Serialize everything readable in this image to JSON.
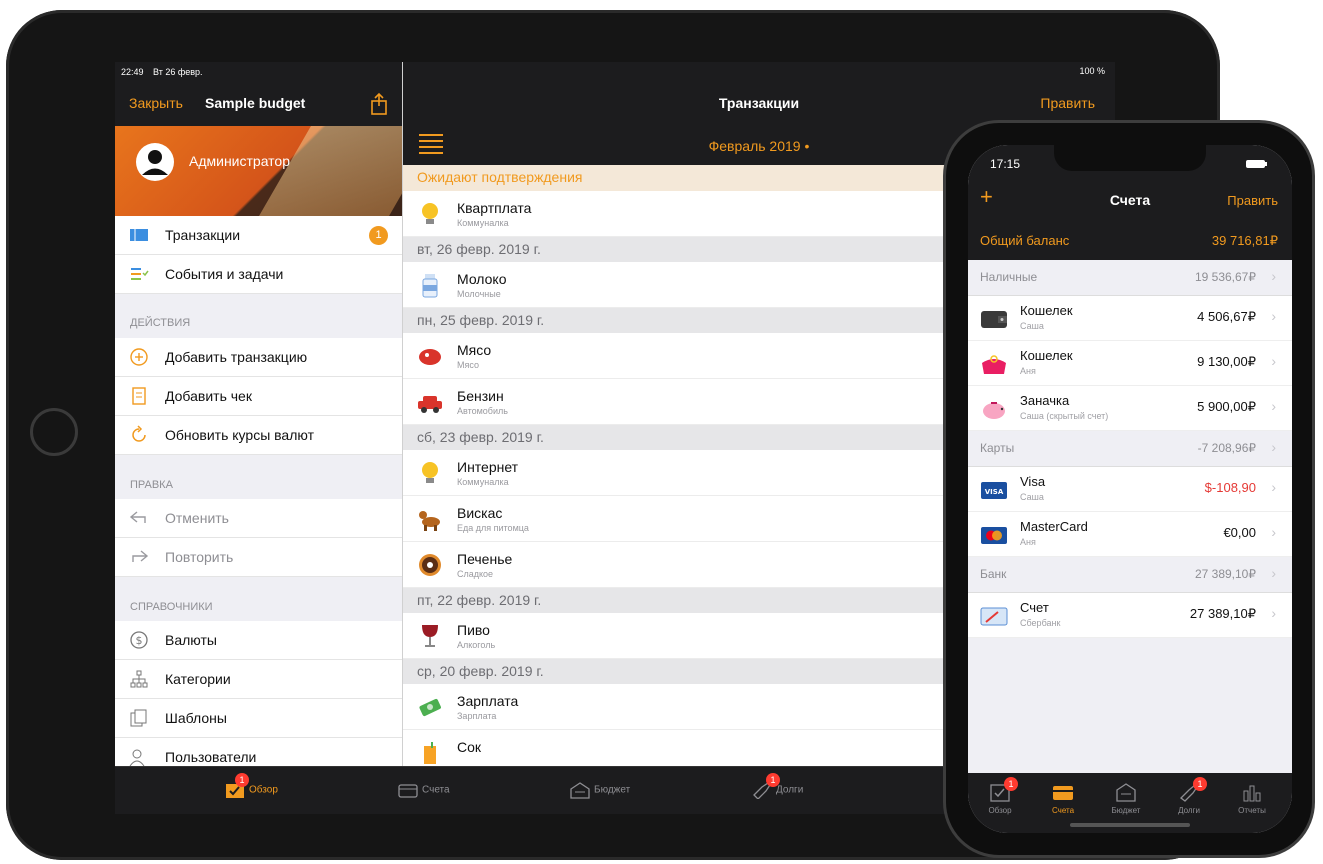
{
  "ipad": {
    "status": {
      "time": "22:49",
      "date": "Вт 26 февр.",
      "battery": "100 %"
    },
    "sidebar": {
      "close_label": "Закрыть",
      "title": "Sample budget",
      "user": "Администратор",
      "top_items": [
        {
          "label": "Транзакции",
          "badge": "1"
        },
        {
          "label": "События и задачи"
        }
      ],
      "actions_header": "ДЕЙСТВИЯ",
      "actions": [
        {
          "label": "Добавить транзакцию"
        },
        {
          "label": "Добавить чек"
        },
        {
          "label": "Обновить курсы валют"
        }
      ],
      "edit_header": "ПРАВКА",
      "edit_items": [
        {
          "label": "Отменить"
        },
        {
          "label": "Повторить"
        }
      ],
      "refs_header": "СПРАВОЧНИКИ",
      "refs": [
        {
          "label": "Валюты"
        },
        {
          "label": "Категории"
        },
        {
          "label": "Шаблоны"
        },
        {
          "label": "Пользователи"
        }
      ]
    },
    "main": {
      "title": "Транзакции",
      "edit_label": "Править",
      "period": "Февраль 2019 •",
      "pending_header": "Ожидают подтверждения",
      "groups": [
        {
          "date": null,
          "items": [
            {
              "name": "Квартплата",
              "category": "Коммуналка",
              "icon": "lightbulb-icon"
            }
          ]
        },
        {
          "date": "вт, 26 февр. 2019 г.",
          "items": [
            {
              "name": "Молоко",
              "category": "Молочные",
              "icon": "milk-icon"
            }
          ]
        },
        {
          "date": "пн, 25 февр. 2019 г.",
          "items": [
            {
              "name": "Мясо",
              "category": "Мясо",
              "icon": "steak-icon"
            },
            {
              "name": "Бензин",
              "category": "Автомобиль",
              "icon": "car-icon"
            }
          ]
        },
        {
          "date": "сб, 23 февр. 2019 г.",
          "items": [
            {
              "name": "Интернет",
              "category": "Коммуналка",
              "icon": "lightbulb-icon"
            },
            {
              "name": "Вискас",
              "category": "Еда для питомца",
              "icon": "dog-icon"
            },
            {
              "name": "Печенье",
              "category": "Сладкое",
              "icon": "donut-icon"
            }
          ]
        },
        {
          "date": "пт, 22 февр. 2019 г.",
          "items": [
            {
              "name": "Пиво",
              "category": "Алкоголь",
              "icon": "wine-icon"
            }
          ]
        },
        {
          "date": "ср, 20 февр. 2019 г.",
          "items": [
            {
              "name": "Зарплата",
              "category": "Зарплата",
              "icon": "money-icon"
            },
            {
              "name": "Сок",
              "category": "",
              "icon": "juice-icon"
            }
          ]
        }
      ]
    },
    "tabs": [
      {
        "label": "Обзор",
        "badge": "1",
        "active": true
      },
      {
        "label": "Счета"
      },
      {
        "label": "Бюджет"
      },
      {
        "label": "Долги",
        "badge": "1"
      }
    ]
  },
  "iphone": {
    "status": {
      "time": "17:15"
    },
    "title": "Счета",
    "add_label": "+",
    "edit_label": "Править",
    "total_label": "Общий баланс",
    "total_value": "39 716,81₽",
    "groups": [
      {
        "name": "Наличные",
        "total": "19 536,67₽",
        "accounts": [
          {
            "name": "Кошелек",
            "owner": "Саша",
            "value": "4 506,67₽",
            "icon": "wallet-icon"
          },
          {
            "name": "Кошелек",
            "owner": "Аня",
            "value": "9 130,00₽",
            "icon": "purse-icon"
          },
          {
            "name": "Заначка",
            "owner": "Саша (скрытый счет)",
            "value": "5 900,00₽",
            "icon": "piggy-bank-icon"
          }
        ]
      },
      {
        "name": "Карты",
        "total": "-7 208,96₽",
        "accounts": [
          {
            "name": "Visa",
            "owner": "Саша",
            "value": "$-108,90",
            "negative": true,
            "icon": "visa-icon"
          },
          {
            "name": "MasterCard",
            "owner": "Аня",
            "value": "€0,00",
            "icon": "mastercard-icon"
          }
        ]
      },
      {
        "name": "Банк",
        "total": "27 389,10₽",
        "accounts": [
          {
            "name": "Счет",
            "owner": "Сбербанк",
            "value": "27 389,10₽",
            "icon": "bank-card-icon"
          }
        ]
      }
    ],
    "tabs": [
      {
        "label": "Обзор",
        "badge": "1"
      },
      {
        "label": "Счета",
        "active": true
      },
      {
        "label": "Бюджет"
      },
      {
        "label": "Долги",
        "badge": "1"
      },
      {
        "label": "Отчеты"
      }
    ]
  },
  "colors": {
    "accent": "#f19a1f",
    "negative": "#e53935",
    "dark": "#1c1c1e",
    "badge": "#ff3b30"
  }
}
